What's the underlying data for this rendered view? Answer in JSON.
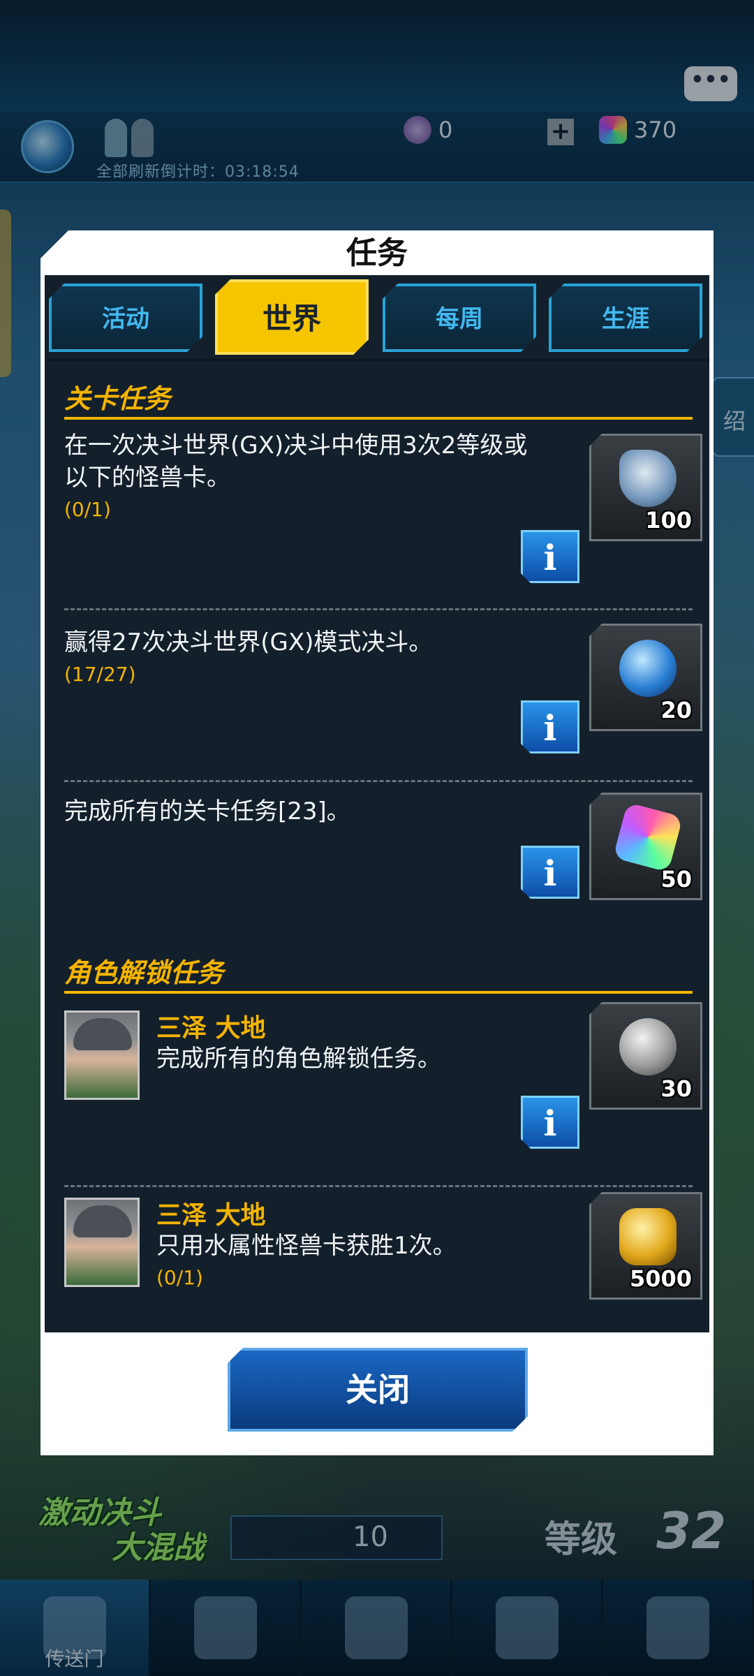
{
  "hud": {
    "countdown": "全部刷新倒计时：03:18:54",
    "orb_count": "0",
    "gem_count": "370",
    "chat_icon": "chat-bubble-icon",
    "right_tab_label": "绍"
  },
  "bottom": {
    "logo_line1": "激动决斗",
    "logo_line2": "大混战",
    "deck_count": "10",
    "level_label": "等级",
    "level_value": "32",
    "nav": [
      {
        "label": "传送门",
        "icon": "portal-icon"
      },
      {
        "label": "",
        "icon": "duel-swords-icon"
      },
      {
        "label": "",
        "icon": "shop-cart-icon"
      },
      {
        "label": "",
        "icon": "deck-cards-icon"
      },
      {
        "label": "",
        "icon": "duelist-emblem-icon"
      }
    ]
  },
  "modal": {
    "title": "任务",
    "tabs": [
      "活动",
      "世界",
      "每周",
      "生涯"
    ],
    "active_tab": "世界",
    "section1_title": "关卡任务",
    "section2_title": "角色解锁任务",
    "quests": [
      {
        "text": "在一次决斗世界(GX)决斗中使用3次2等级或以下的怪兽卡。",
        "progress": "(0/1)",
        "reward_icon": "key-icon",
        "reward_count": "100"
      },
      {
        "text": "赢得27次决斗世界(GX)模式决斗。",
        "progress": "(17/27)",
        "reward_icon": "precious-orb-icon",
        "reward_count": "20"
      },
      {
        "text": "完成所有的关卡任务[23]。",
        "progress": "",
        "reward_icon": "gem-icon",
        "reward_count": "50"
      }
    ],
    "char_quests": [
      {
        "name": "三泽 大地",
        "text": "完成所有的角色解锁任务。",
        "progress": "",
        "reward_icon": "earth-orb-icon",
        "reward_count": "30"
      },
      {
        "name": "三泽 大地",
        "text": "只用水属性怪兽卡获胜1次。",
        "progress": "(0/1)",
        "reward_icon": "gold-coins-icon",
        "reward_count": "5000"
      }
    ],
    "info_label": "i",
    "close_label": "关闭"
  }
}
